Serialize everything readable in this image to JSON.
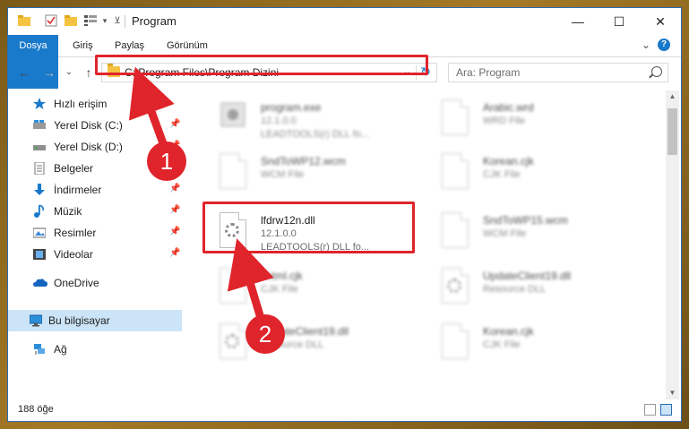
{
  "window": {
    "title": "Program",
    "minimize_glyph": "—",
    "maximize_glyph": "☐",
    "close_glyph": "✕"
  },
  "ribbon": {
    "tabs": [
      "Dosya",
      "Giriş",
      "Paylaş",
      "Görünüm"
    ],
    "help_glyph": "?",
    "collapse_glyph": "⌄"
  },
  "nav": {
    "back_glyph": "←",
    "forward_glyph": "→",
    "recent_glyph": "⌄",
    "up_glyph": "↑",
    "address": "C:\\Program Files\\Program Dizini",
    "address_dropdown_glyph": "⌄",
    "refresh_glyph": "↻",
    "search_placeholder": "Ara: Program"
  },
  "sidebar": {
    "items": [
      {
        "label": "Hızlı erişim",
        "icon": "star-icon",
        "pinned": false
      },
      {
        "label": "Yerel Disk (C:)",
        "icon": "drive-icon",
        "pinned": true
      },
      {
        "label": "Yerel Disk (D:)",
        "icon": "drive-icon",
        "pinned": true
      },
      {
        "label": "Belgeler",
        "icon": "documents-icon",
        "pinned": true
      },
      {
        "label": "İndirmeler",
        "icon": "downloads-icon",
        "pinned": true
      },
      {
        "label": "Müzik",
        "icon": "music-icon",
        "pinned": true
      },
      {
        "label": "Resimler",
        "icon": "pictures-icon",
        "pinned": true
      },
      {
        "label": "Videolar",
        "icon": "videos-icon",
        "pinned": true
      },
      {
        "label": "OneDrive",
        "icon": "cloud-icon",
        "pinned": false
      },
      {
        "label": "Bu bilgisayar",
        "icon": "computer-icon",
        "pinned": false,
        "selected": true
      },
      {
        "label": "Ağ",
        "icon": "network-icon",
        "pinned": false
      }
    ],
    "pin_glyph": "📌"
  },
  "files": [
    {
      "name": "program.exe",
      "line1": "12.1.0.0",
      "line2": "LEADTOOLS(r) DLL fo...",
      "blurred": true,
      "kind": "exe"
    },
    {
      "name": "Arabic.wrd",
      "line1": "WRD File",
      "line2": "",
      "blurred": true,
      "kind": "doc"
    },
    {
      "name": "SndToWP12.wcm",
      "line1": "WCM File",
      "line2": "",
      "blurred": true,
      "kind": "doc"
    },
    {
      "name": "Korean.cjk",
      "line1": "CJK File",
      "line2": "",
      "blurred": true,
      "kind": "doc"
    },
    {
      "name": "lfdrw12n.dll",
      "line1": "12.1.0.0",
      "line2": "LEADTOOLS(r) DLL fo...",
      "blurred": false,
      "kind": "dll"
    },
    {
      "name": "SndToWP15.wcm",
      "line1": "WCM File",
      "line2": "",
      "blurred": true,
      "kind": "doc"
    },
    {
      "name": "lfhtml.cjk",
      "line1": "CJK File",
      "line2": "",
      "blurred": true,
      "kind": "doc"
    },
    {
      "name": "UpdateClient19.dll",
      "line1": "Resource DLL",
      "line2": "",
      "blurred": true,
      "kind": "dll"
    },
    {
      "name": "UpdateClient19.dll",
      "line1": "Resource DLL",
      "line2": "",
      "blurred": true,
      "kind": "dll"
    },
    {
      "name": "Korean.cjk",
      "line1": "CJK File",
      "line2": "",
      "blurred": true,
      "kind": "doc"
    }
  ],
  "status": {
    "count": "188 öğe"
  },
  "annotations": {
    "badge1": "1",
    "badge2": "2",
    "color": "#e0242b"
  }
}
